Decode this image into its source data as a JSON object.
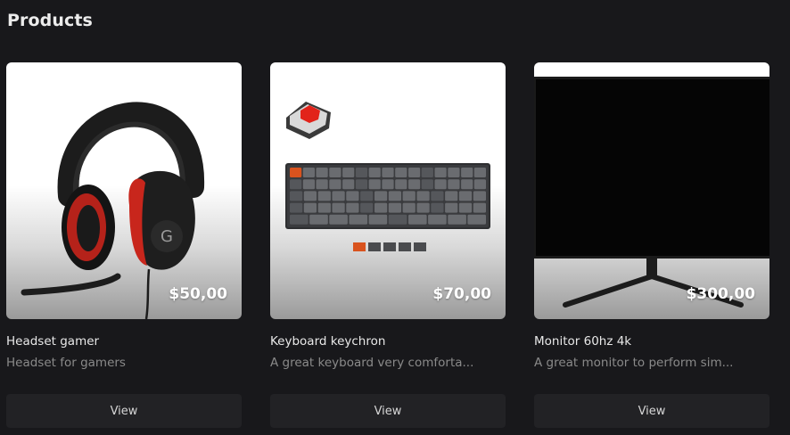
{
  "page": {
    "title": "Products"
  },
  "products": [
    {
      "name": "Headset gamer",
      "description": "Headset for gamers",
      "price": "$50,00",
      "button_label": "View",
      "image_icon": "headset-icon"
    },
    {
      "name": "Keyboard keychron",
      "description": "A great keyboard very comforta...",
      "price": "$70,00",
      "button_label": "View",
      "image_icon": "keyboard-icon"
    },
    {
      "name": "Monitor 60hz 4k",
      "description": "A great monitor to perform sim...",
      "price": "$300,00",
      "button_label": "View",
      "image_icon": "monitor-icon"
    }
  ],
  "colors": {
    "background": "#18181b",
    "button": "#222225",
    "headset_accent": "#c8261c",
    "keyboard_switch": "#e2231a"
  }
}
